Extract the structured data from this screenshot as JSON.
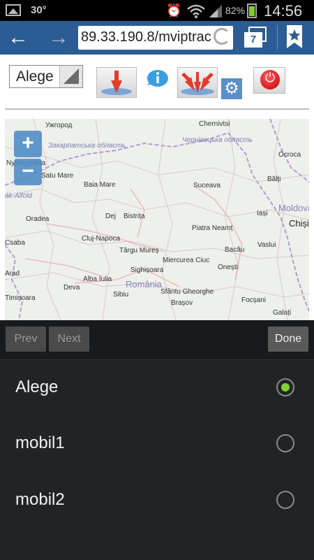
{
  "status_bar": {
    "temperature": "30°",
    "battery_percent": "82%",
    "time": "14:56",
    "icons": [
      "gallery-icon",
      "alarm-icon",
      "wifi-icon",
      "signal-icon",
      "battery-icon"
    ]
  },
  "browser": {
    "url": "89.33.190.8/mviptrac",
    "tab_count": "7",
    "icons": [
      "back-arrow-icon",
      "forward-arrow-icon",
      "reload-icon",
      "tabs-icon",
      "bookmark-star-icon"
    ]
  },
  "toolbar": {
    "select_value": "Alege",
    "buttons": [
      "single-vehicle-icon",
      "info-bubble-icon",
      "all-vehicles-icon",
      "settings-gear-icon",
      "power-icon"
    ]
  },
  "map": {
    "zoom_in": "+",
    "zoom_out": "−",
    "labels": [
      {
        "text": "Ужгород",
        "cls": ""
      },
      {
        "text": "Закарпатська область",
        "cls": "region"
      },
      {
        "text": "Чернівецька область",
        "cls": "region"
      },
      {
        "text": "Chernivtsi",
        "cls": ""
      },
      {
        "text": "Nyíregyháza",
        "cls": ""
      },
      {
        "text": "Satu Mare",
        "cls": ""
      },
      {
        "text": "Baia Mare",
        "cls": ""
      },
      {
        "text": "Suceava",
        "cls": ""
      },
      {
        "text": "Bălți",
        "cls": ""
      },
      {
        "text": "Ócroca",
        "cls": ""
      },
      {
        "text": "Moldova",
        "cls": "country"
      },
      {
        "text": "ák-Alföld",
        "cls": "region"
      },
      {
        "text": "Oradea",
        "cls": ""
      },
      {
        "text": "Dej",
        "cls": ""
      },
      {
        "text": "Bistrița",
        "cls": ""
      },
      {
        "text": "Iași",
        "cls": ""
      },
      {
        "text": "Chiși",
        "cls": "big"
      },
      {
        "text": "Piatra Neamț",
        "cls": ""
      },
      {
        "text": "Cluj-Napoca",
        "cls": ""
      },
      {
        "text": "Csaba",
        "cls": ""
      },
      {
        "text": "Târgu Mureș",
        "cls": ""
      },
      {
        "text": "Vaslui",
        "cls": ""
      },
      {
        "text": "Bacău",
        "cls": ""
      },
      {
        "text": "Miercurea Ciuc",
        "cls": ""
      },
      {
        "text": "Onești",
        "cls": ""
      },
      {
        "text": "Sighișoara",
        "cls": ""
      },
      {
        "text": "Arad",
        "cls": ""
      },
      {
        "text": "Alba Iulia",
        "cls": ""
      },
      {
        "text": "România",
        "cls": "country"
      },
      {
        "text": "Deva",
        "cls": ""
      },
      {
        "text": "Sfântu Gheorghe",
        "cls": ""
      },
      {
        "text": "Sibiu",
        "cls": ""
      },
      {
        "text": "Brașov",
        "cls": ""
      },
      {
        "text": "Focșani",
        "cls": ""
      },
      {
        "text": "Timișoara",
        "cls": ""
      },
      {
        "text": "Galați",
        "cls": ""
      }
    ]
  },
  "form_nav": {
    "prev": "Prev",
    "next": "Next",
    "done": "Done"
  },
  "picker": {
    "options": [
      {
        "label": "Alege",
        "selected": true
      },
      {
        "label": "mobil1",
        "selected": false
      },
      {
        "label": "mobil2",
        "selected": false
      }
    ]
  },
  "colors": {
    "browser_bar": "#2c5c94",
    "radio_selected": "#7fd12e",
    "picker_bg": "#222324"
  }
}
